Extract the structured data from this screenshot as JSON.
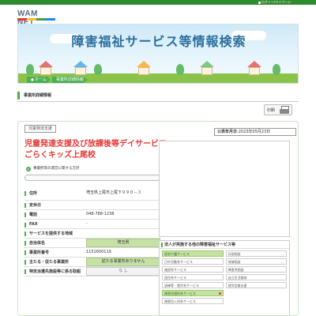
{
  "header": {
    "top_link": "ログイン/マイページ",
    "logo": "WAM NET",
    "banner_title": "障害福祉サービス等情報検索"
  },
  "breadcrumb": [
    {
      "label": "ホーム"
    },
    {
      "label": "事業所詳細情報"
    }
  ],
  "page_title": "事業所詳細情報",
  "print_label": "印刷",
  "facility": {
    "service_tag": "児童発達支援",
    "pub_date_label": "公表年月日",
    "pub_date": "2023年05月23日",
    "name": "児童発達支援及び放課後等デイサービスごらくキッズ上尾校",
    "policy_label": "事業所等の運営に関する方針"
  },
  "info_rows": [
    {
      "label": "住所",
      "value": "埼玉県上尾市上尾下９９０－３",
      "style": "plain"
    },
    {
      "label": "定休日",
      "value": "",
      "style": "plain"
    },
    {
      "label": "電話",
      "value": "048-788-1238",
      "style": "plain"
    },
    {
      "label": "FAX",
      "value": "-",
      "style": "plain"
    },
    {
      "label": "サービスを提供する地域",
      "value": "",
      "style": "plain"
    },
    {
      "label": "自治体名",
      "value": "埼玉県",
      "style": "green"
    },
    {
      "label": "事業所番号",
      "value": "1151600119",
      "style": "plain"
    },
    {
      "label": "主たる・従たる事業所",
      "value": "従たる事業所ありません",
      "style": "green"
    },
    {
      "label": "特定派遣先施設等に係る取組",
      "value": "な し",
      "style": "muted"
    }
  ],
  "corp_panel": {
    "title": "法人が実施する他の障害福祉サービス等",
    "col1": [
      {
        "label": "居宅介護サービス",
        "on": true
      },
      {
        "label": "日中活動系サービス",
        "on": false
      },
      {
        "label": "施設系サービス",
        "on": false
      },
      {
        "label": "居住系サービス",
        "on": false
      },
      {
        "label": "訓練等・就労系サービス",
        "on": false
      },
      {
        "label": "障害児通所系サービス",
        "on": true
      },
      {
        "label": "障害児入所系サービス",
        "on": false
      }
    ],
    "col2": [
      {
        "label": "計画相談",
        "on": false
      },
      {
        "label": "地域相談",
        "on": false
      },
      {
        "label": "障害児相談",
        "on": false
      },
      {
        "label": "自立生活援助",
        "on": false
      },
      {
        "label": "就労定着支援",
        "on": false
      }
    ],
    "more_text": "…"
  },
  "colors": {
    "accent": "#2e8b2e",
    "title_red": "#e53935",
    "banner_text": "#2b6f9e"
  }
}
